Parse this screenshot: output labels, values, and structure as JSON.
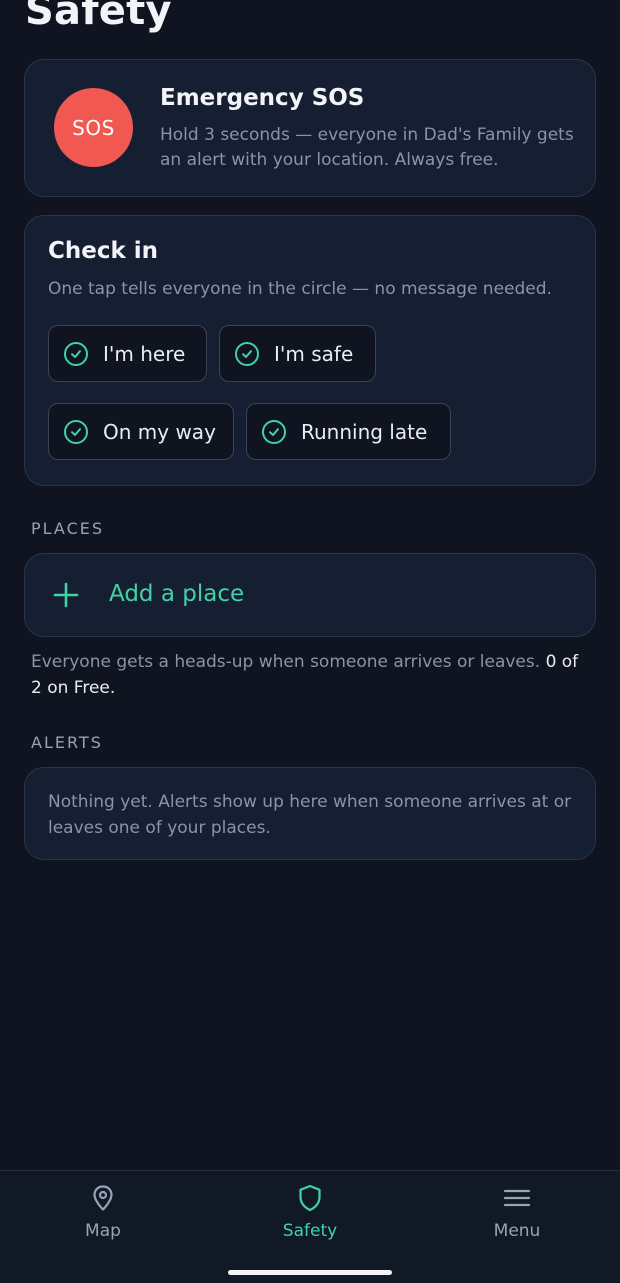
{
  "page": {
    "title": "Safety"
  },
  "sos": {
    "button_label": "SOS",
    "title": "Emergency SOS",
    "description": "Hold 3 seconds — everyone in Dad's Family gets an alert with your location. Always free."
  },
  "checkin": {
    "title": "Check in",
    "description": "One tap tells everyone in the circle — no message needed.",
    "options": [
      "I'm here",
      "I'm safe",
      "On my way",
      "Running late"
    ]
  },
  "places": {
    "section_label": "PLACES",
    "add_label": "Add a place",
    "note": "Everyone gets a heads-up when someone arrives or leaves.",
    "usage": "0 of 2 on Free."
  },
  "alerts": {
    "section_label": "ALERTS",
    "empty_text": "Nothing yet. Alerts show up here when someone arrives at or leaves one of your places."
  },
  "nav": {
    "items": [
      {
        "label": "Map",
        "icon": "map-pin-icon"
      },
      {
        "label": "Safety",
        "icon": "shield-icon",
        "active": true
      },
      {
        "label": "Menu",
        "icon": "menu-icon"
      }
    ]
  },
  "colors": {
    "accent": "#3fd3a6",
    "sos": "#f1584f",
    "background": "#0f1420",
    "card": "#161e31"
  }
}
